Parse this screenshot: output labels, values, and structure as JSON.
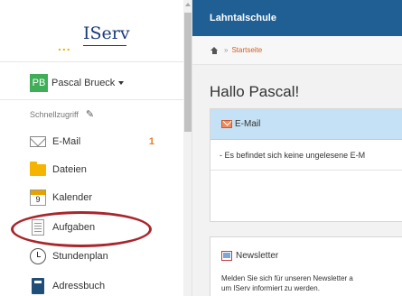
{
  "sidebar": {
    "logo": {
      "dots": "...",
      "name": "IServ"
    },
    "user": {
      "initials": "PB",
      "name": "Pascal Brueck"
    },
    "quick_access_label": "Schnellzugriff",
    "items": [
      {
        "label": "E-Mail",
        "icon": "mail-icon",
        "badge": "1"
      },
      {
        "label": "Dateien",
        "icon": "folder-icon"
      },
      {
        "label": "Kalender",
        "icon": "calendar-icon",
        "icon_text": "9"
      },
      {
        "label": "Aufgaben",
        "icon": "task-icon"
      },
      {
        "label": "Stundenplan",
        "icon": "clock-icon"
      },
      {
        "label": "Adressbuch",
        "icon": "addressbook-icon"
      }
    ]
  },
  "header": {
    "title": "Lahntalschule"
  },
  "breadcrumb": {
    "separator": "»",
    "current": "Startseite"
  },
  "main": {
    "greeting": "Hallo Pascal!",
    "email_panel": {
      "title": "E-Mail",
      "message": "- Es befindet sich keine ungelesene E-M"
    },
    "newsletter_panel": {
      "title": "Newsletter",
      "text_line1": "Melden Sie sich für unseren Newsletter a",
      "text_line2": "um IServ informiert zu werden."
    }
  },
  "colors": {
    "header_bg": "#1f5f93",
    "email_panel_bg": "#c5e1f5",
    "avatar_bg": "#3fae57",
    "badge": "#e67e22",
    "link": "#d06020",
    "highlight": "#a8262c"
  }
}
